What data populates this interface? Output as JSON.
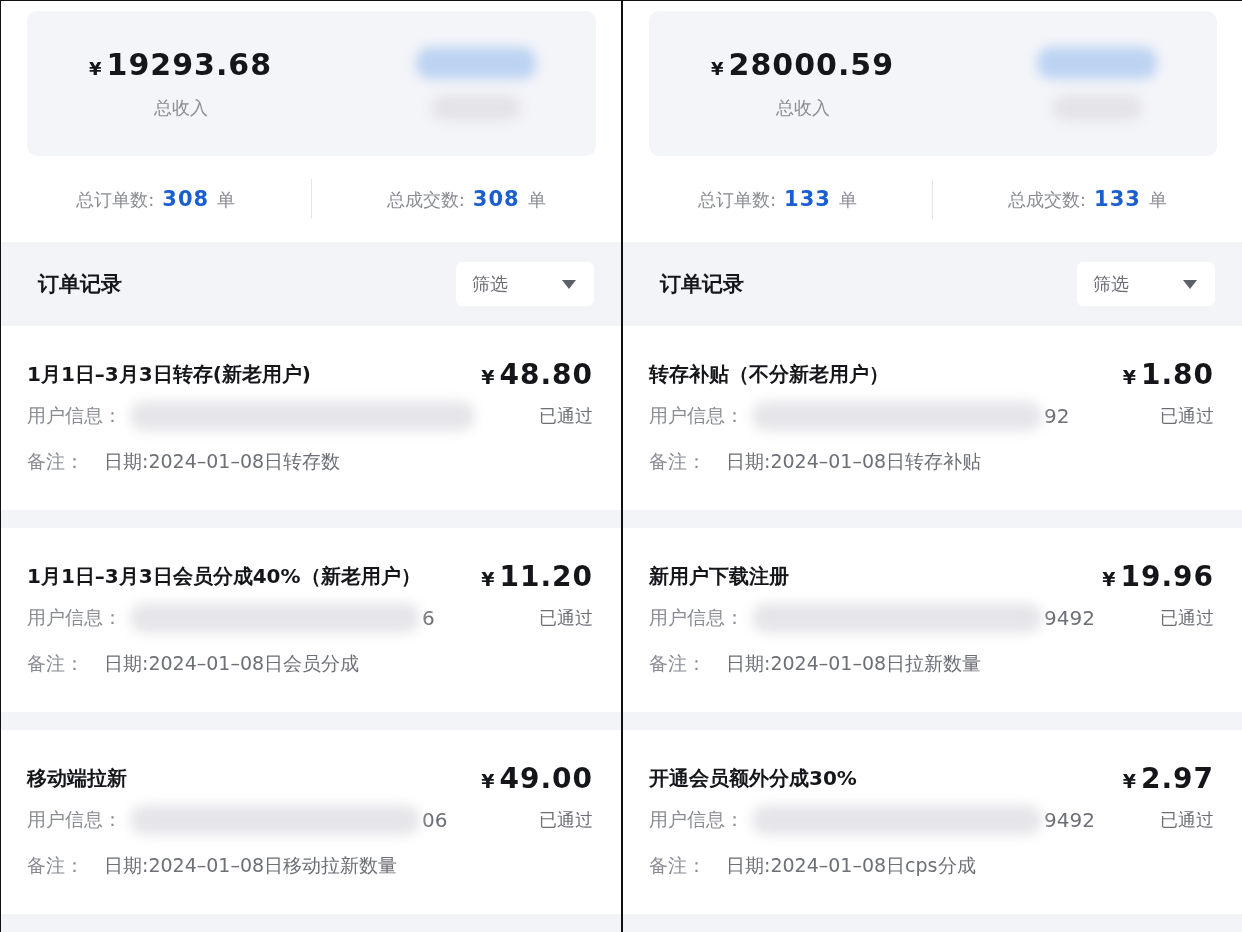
{
  "panels": [
    {
      "summary": {
        "currency": "¥",
        "amount": "19293.68",
        "label": "总收入"
      },
      "stats": [
        {
          "label": "总订单数:",
          "value": "308",
          "unit": "单"
        },
        {
          "label": "总成交数:",
          "value": "308",
          "unit": "单"
        }
      ],
      "section_title": "订单记录",
      "filter": {
        "label": "筛选"
      },
      "orders": [
        {
          "title": "1月1日–3月3日转存(新老用户)",
          "currency": "¥",
          "amount": "48.80",
          "user_label": "用户信息：",
          "status": "已通过",
          "note_label": "备注：",
          "note": "日期:2024–01–08日转存数"
        },
        {
          "title": "1月1日–3月3日会员分成40%（新老用户）",
          "currency": "¥",
          "amount": "11.20",
          "user_label": "用户信息：",
          "user_tail": "6",
          "status": "已通过",
          "note_label": "备注：",
          "note": "日期:2024–01–08日会员分成"
        },
        {
          "title": "移动端拉新",
          "currency": "¥",
          "amount": "49.00",
          "user_label": "用户信息：",
          "user_tail": "06",
          "status": "已通过",
          "note_label": "备注：",
          "note": "日期:2024–01–08日移动拉新数量"
        }
      ]
    },
    {
      "summary": {
        "currency": "¥",
        "amount": "28000.59",
        "label": "总收入"
      },
      "stats": [
        {
          "label": "总订单数:",
          "value": "133",
          "unit": "单"
        },
        {
          "label": "总成交数:",
          "value": "133",
          "unit": "单"
        }
      ],
      "section_title": "订单记录",
      "filter": {
        "label": "筛选"
      },
      "orders": [
        {
          "title": "转存补贴（不分新老用户）",
          "currency": "¥",
          "amount": "1.80",
          "user_label": "用户信息：",
          "user_tail": "92",
          "status": "已通过",
          "note_label": "备注：",
          "note": "日期:2024–01–08日转存补贴"
        },
        {
          "title": "新用户下载注册",
          "currency": "¥",
          "amount": "19.96",
          "user_label": "用户信息：",
          "user_tail": "9492",
          "status": "已通过",
          "note_label": "备注：",
          "note": "日期:2024–01–08日拉新数量"
        },
        {
          "title": "开通会员额外分成30%",
          "currency": "¥",
          "amount": "2.97",
          "user_label": "用户信息：",
          "user_tail": "9492",
          "status": "已通过",
          "note_label": "备注：",
          "note": "日期:2024–01–08日cps分成"
        }
      ]
    }
  ]
}
